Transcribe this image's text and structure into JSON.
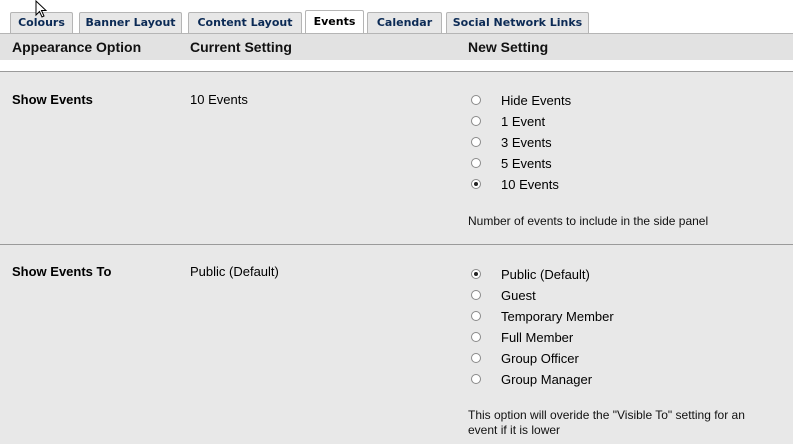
{
  "tabs": [
    {
      "label": "Colours",
      "active": false
    },
    {
      "label": "Banner Layout",
      "active": false
    },
    {
      "label": "Content Layout",
      "active": false
    },
    {
      "label": "Events",
      "active": true
    },
    {
      "label": "Calendar",
      "active": false
    },
    {
      "label": "Social Network Links",
      "active": false
    }
  ],
  "header": {
    "col1": "Appearance Option",
    "col2": "Current Setting",
    "col3": "New Setting"
  },
  "sections": [
    {
      "name": "Show Events",
      "current": "10 Events",
      "options": [
        {
          "label": "Hide Events",
          "checked": false
        },
        {
          "label": "1 Event",
          "checked": false
        },
        {
          "label": "3 Events",
          "checked": false
        },
        {
          "label": "5 Events",
          "checked": false
        },
        {
          "label": "10 Events",
          "checked": true
        }
      ],
      "help": "Number of events to include in the side panel"
    },
    {
      "name": "Show Events To",
      "current": "Public (Default)",
      "options": [
        {
          "label": "Public (Default)",
          "checked": true
        },
        {
          "label": "Guest",
          "checked": false
        },
        {
          "label": "Temporary Member",
          "checked": false
        },
        {
          "label": "Full Member",
          "checked": false
        },
        {
          "label": "Group Officer",
          "checked": false
        },
        {
          "label": "Group Manager",
          "checked": false
        }
      ],
      "help_line1": "This option will overide the \"Visible To\" setting for an",
      "help_line2": "event if it is lower"
    }
  ],
  "colors": {
    "header_bg": "#e2e2e2",
    "section_bg": "#e8e8e8",
    "tab_text": "#0b2a55",
    "divider": "#9a9a9a"
  },
  "icons": [
    "mouse-cursor-icon"
  ]
}
